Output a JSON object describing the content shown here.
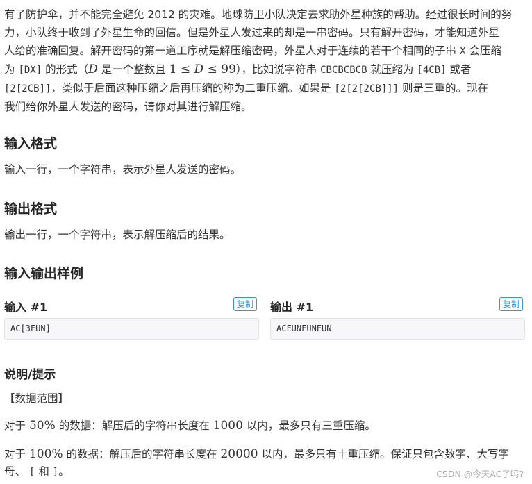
{
  "description": {
    "line1": "有了防护伞，并不能完全避免 2012 的灾难。地球防卫小队决定去求助外星种族的帮助。经过很长时间的努",
    "line2": "力，小队终于收到了外星生命的回信。但是外星人发过来的却是一串密码。只有解开密码，才能知道外星",
    "line3": "人给的准确回复。解开密码的第一道工序就是解压缩密码，外星人对于连续的若干个相同的子串",
    "line3_code": "X",
    "line3_end": "会压缩",
    "line4_pre": "为",
    "line4_code": "[DX]",
    "line4_mid": "的形式（",
    "line4_math_D": "D",
    "line4_mid2": "是一个整数且",
    "line4_math_range_1": "1",
    "line4_math_le1": "≤",
    "line4_math_D2": "D",
    "line4_math_le2": "≤",
    "line4_math_99": "99",
    "line4_mid3": "），比如说字符串",
    "line4_code2": "CBCBCBCB",
    "line4_mid4": "就压缩为",
    "line4_code3": "[4CB]",
    "line4_end": "或者",
    "line5_code1": "[2[2CB]]",
    "line5_mid": "，类似于后面这种压缩之后再压缩的称为二重压缩。如果是",
    "line5_code2": "[2[2[2CB]]]",
    "line5_end": "则是三重的。现在",
    "line6": "我们给你外星人发送的密码，请你对其进行解压缩。"
  },
  "input_format": {
    "title": "输入格式",
    "text": "输入一行，一个字符串，表示外星人发送的密码。"
  },
  "output_format": {
    "title": "输出格式",
    "text": "输出一行，一个字符串，表示解压缩后的结果。"
  },
  "samples": {
    "title": "输入输出样例",
    "input_label": "输入 #1",
    "output_label": "输出 #1",
    "copy_label": "复制",
    "input_value": "AC[3FUN]",
    "output_value": "ACFUNFUNFUN"
  },
  "hints": {
    "title": "说明/提示",
    "range_label": "【数据范围】",
    "h1_pre": "对于",
    "h1_pct": "50%",
    "h1_mid": "的数据：解压后的字符串长度在",
    "h1_num": "1000",
    "h1_end": "以内，最多只有三重压缩。",
    "h2_pre": "对于",
    "h2_pct": "100%",
    "h2_mid": "的数据：解压后的字符串长度在",
    "h2_num": "20000",
    "h2_end": "以内，最多只有十重压缩。保证只包含数字、大写字",
    "h2_line2_pre": "母、",
    "h2_code1": "[",
    "h2_and": "和",
    "h2_code2": "]",
    "h2_line2_end": "。"
  },
  "watermark": "CSDN @今天AC了吗?"
}
